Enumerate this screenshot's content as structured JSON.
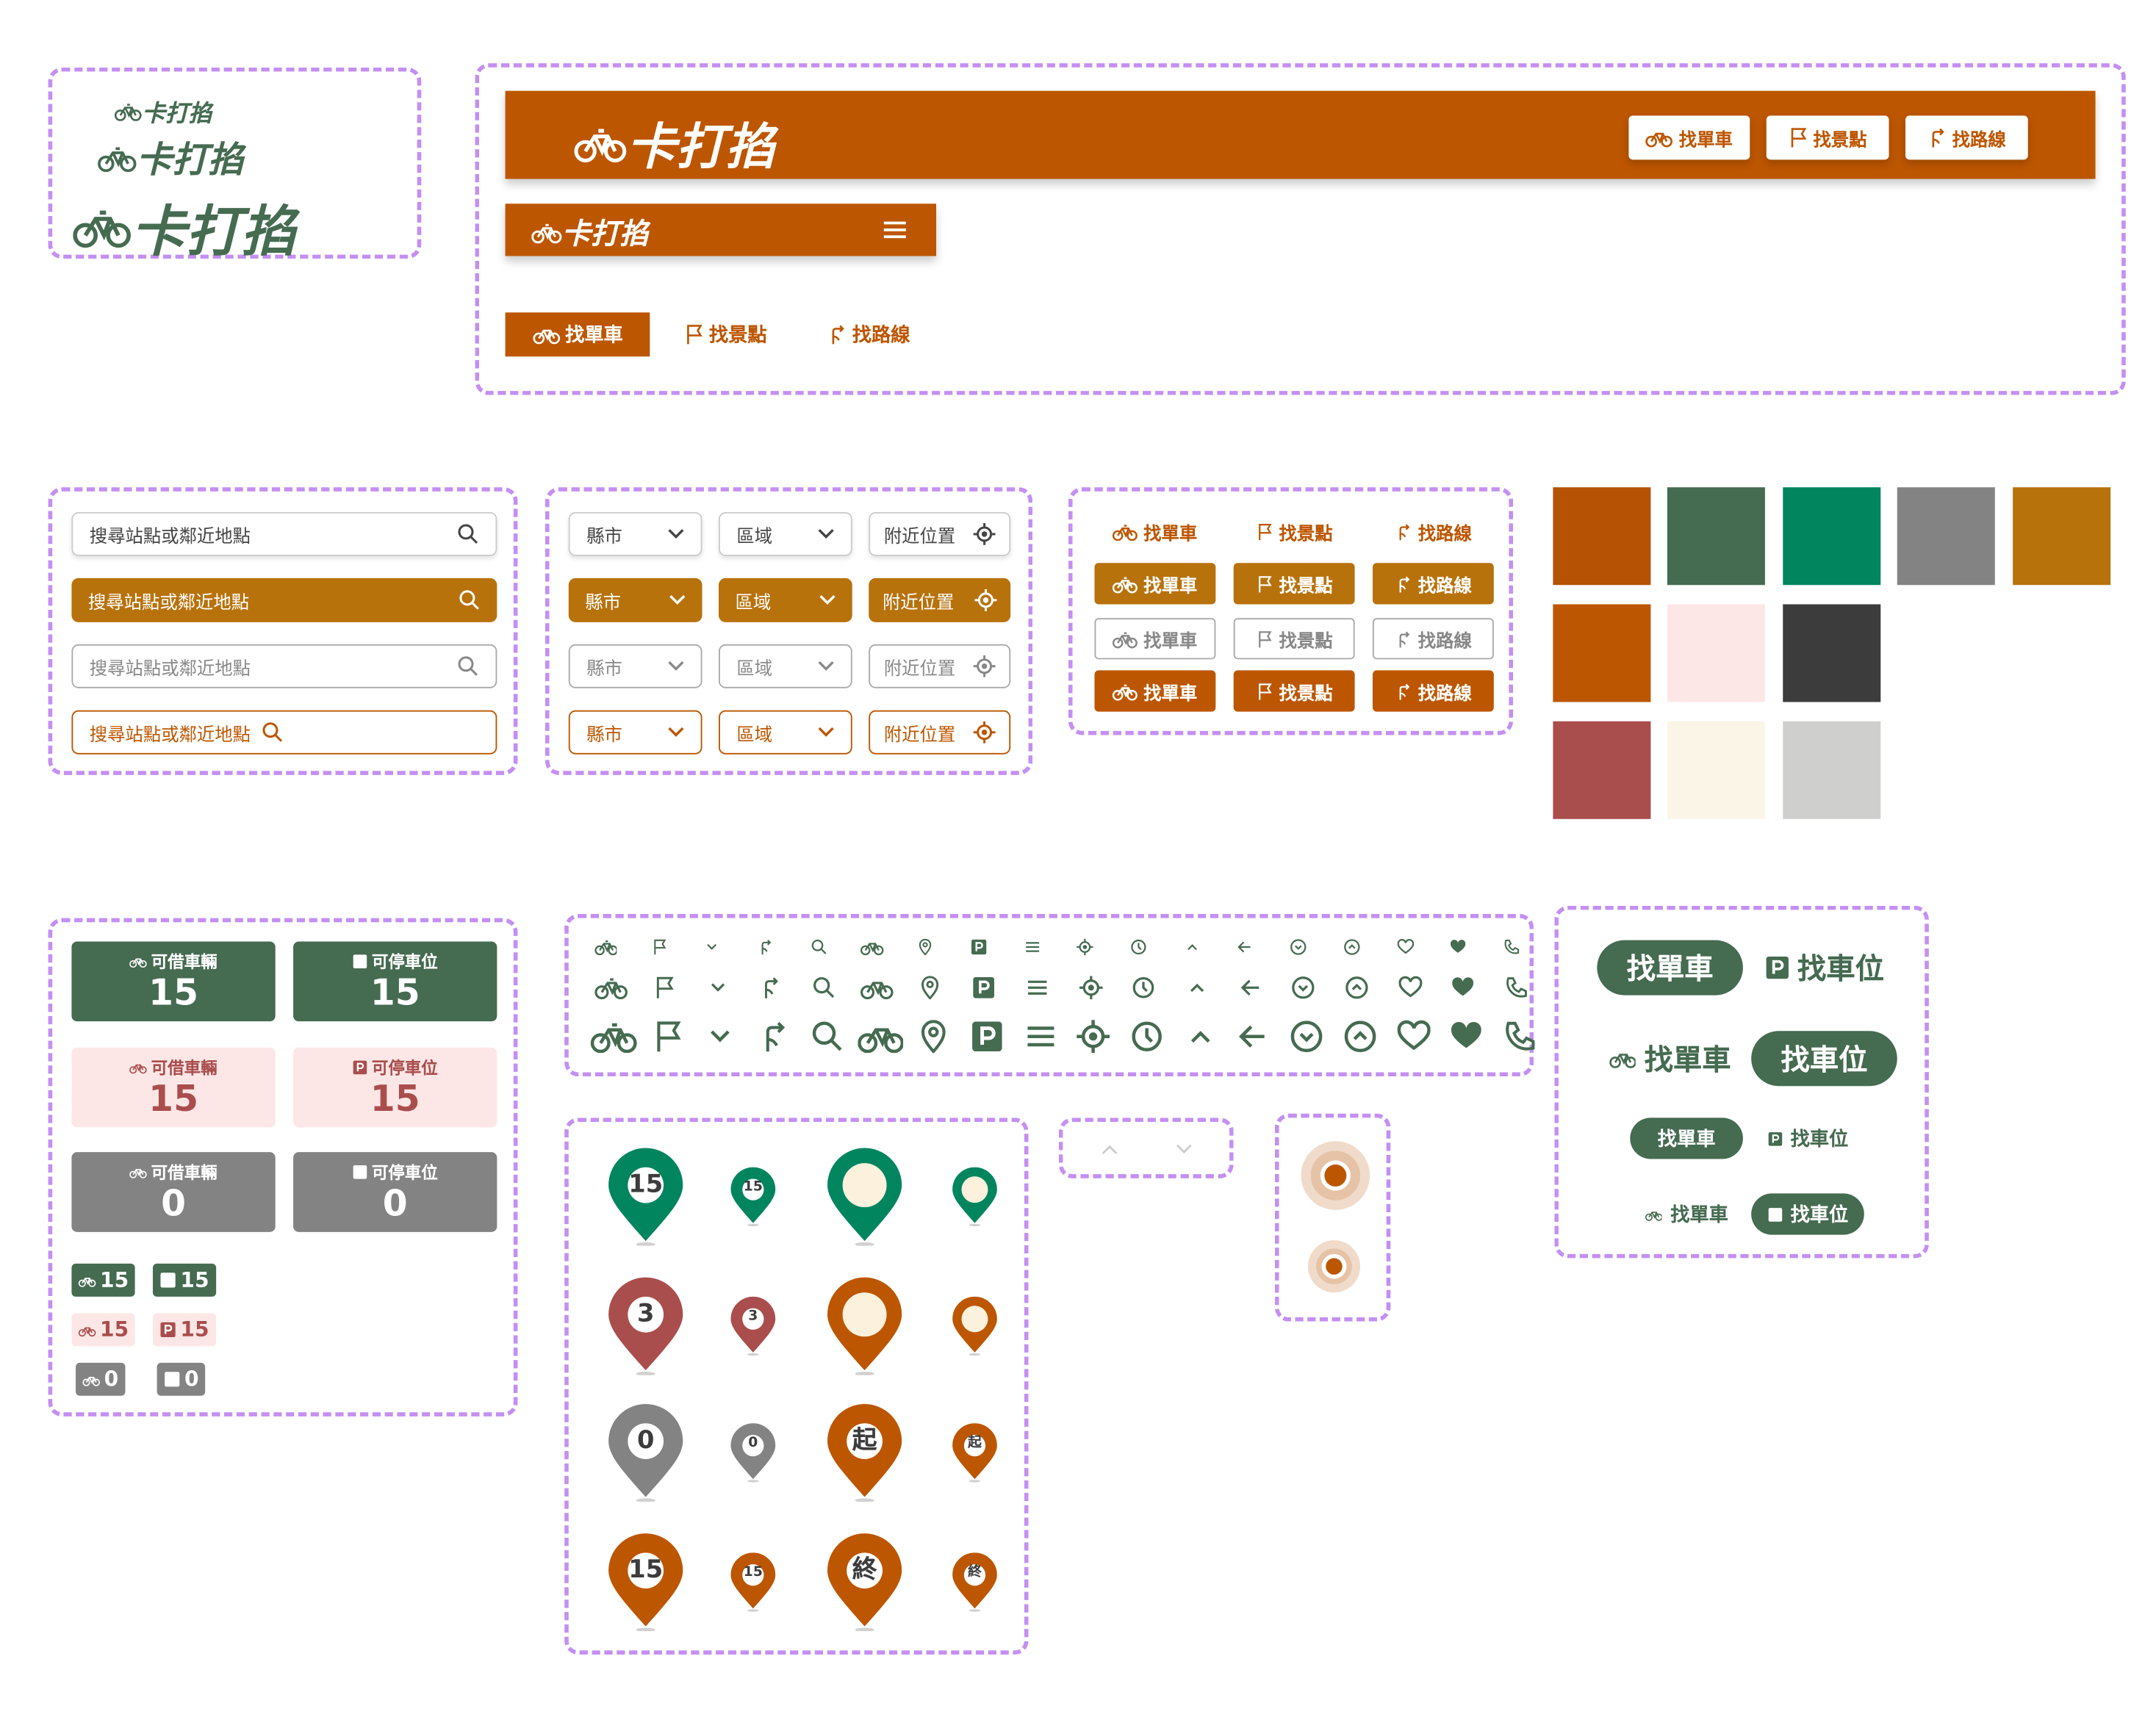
{
  "brand": {
    "name": "卡打掐"
  },
  "nav": {
    "items": [
      "找單車",
      "找景點",
      "找路線"
    ]
  },
  "search": {
    "placeholder": "搜尋站點或鄰近地點"
  },
  "filters": {
    "city": "縣市",
    "district": "區域",
    "nearby": "附近位置"
  },
  "palette": {
    "row1": [
      "#b55204",
      "#456b50",
      "#00855f",
      "#838383",
      "#b8720c"
    ],
    "row2": [
      "#bd5600",
      "#fde7e6",
      "#3c3c3c"
    ],
    "row3": [
      "#a94e4d",
      "#fbf5e7",
      "#cfd0cd"
    ]
  },
  "stats": {
    "bikes_label": "可借車輛",
    "parking_label": "可停車位",
    "cards": [
      {
        "bikes": "15",
        "parking": "15"
      },
      {
        "bikes": "15",
        "parking": "15"
      },
      {
        "bikes": "0",
        "parking": "0"
      }
    ],
    "badges": [
      {
        "bikes": "15",
        "parking": "15"
      },
      {
        "bikes": "15",
        "parking": "15"
      },
      {
        "bikes": "0",
        "parking": "0"
      }
    ]
  },
  "markers": {
    "rows": [
      [
        "15",
        "15",
        "",
        ""
      ],
      [
        "3",
        "3",
        "",
        ""
      ],
      [
        "0",
        "0",
        "起",
        "起"
      ],
      [
        "15",
        "15",
        "終",
        "終"
      ]
    ]
  },
  "mode_toggle": {
    "bike": "找單車",
    "parking": "找車位"
  },
  "icons": [
    "bike-icon",
    "flag-icon",
    "chevron-down-icon",
    "route-icon",
    "search-icon",
    "bike-outline-icon",
    "location-pin-icon",
    "parking-icon",
    "menu-icon",
    "locate-target-icon",
    "clock-icon",
    "chevron-up-icon",
    "arrow-left-icon",
    "circle-chevron-down-icon",
    "circle-chevron-up-icon",
    "heart-outline-icon",
    "heart-filled-icon",
    "phone-icon"
  ],
  "colors": {
    "accent": "#bd5600",
    "green": "#456b50",
    "teal": "#00855f",
    "gray": "#838383",
    "ochre": "#b8720c",
    "red": "#a94e4d",
    "pink": "#fde7e6"
  }
}
